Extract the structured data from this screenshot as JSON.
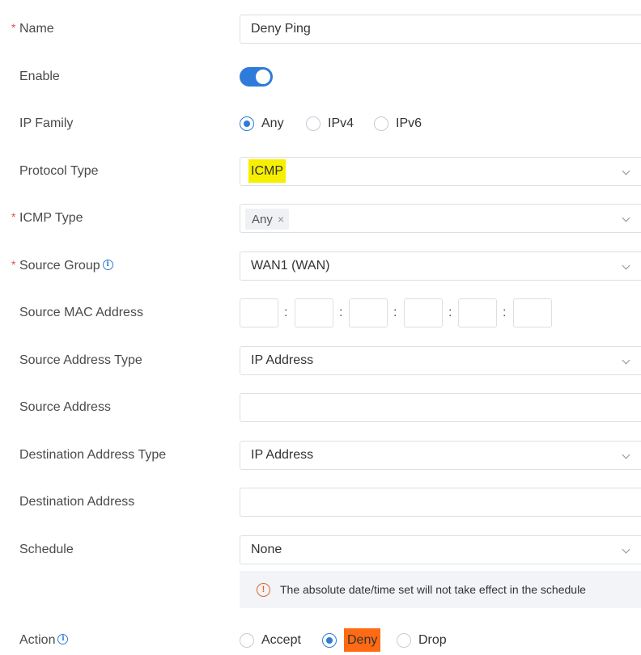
{
  "form": {
    "name": {
      "label": "Name",
      "required": "*",
      "value": "Deny Ping"
    },
    "enable": {
      "label": "Enable",
      "on": true
    },
    "ip_family": {
      "label": "IP Family",
      "options": [
        "Any",
        "IPv4",
        "IPv6"
      ],
      "selected": "Any"
    },
    "protocol_type": {
      "label": "Protocol Type",
      "value": "ICMP"
    },
    "icmp_type": {
      "label": "ICMP Type",
      "required": "*",
      "tag": "Any",
      "tag_remove": "×"
    },
    "source_group": {
      "label": "Source Group",
      "required": "*",
      "value": "WAN1 (WAN)",
      "info": "i"
    },
    "source_mac": {
      "label": "Source MAC Address",
      "separator": ":"
    },
    "source_address_type": {
      "label": "Source Address Type",
      "value": "IP Address"
    },
    "source_address": {
      "label": "Source Address",
      "value": ""
    },
    "destination_address_type": {
      "label": "Destination Address Type",
      "value": "IP Address"
    },
    "destination_address": {
      "label": "Destination Address",
      "value": ""
    },
    "schedule": {
      "label": "Schedule",
      "value": "None",
      "notice": "The absolute date/time set will not take effect in the schedule",
      "notice_icon": "!"
    },
    "action": {
      "label": "Action",
      "info": "i",
      "options": [
        "Accept",
        "Deny",
        "Drop"
      ],
      "selected": "Deny"
    }
  },
  "colors": {
    "accent": "#2f7bd9",
    "required": "#e34d59",
    "highlight_yellow": "#f7ef00",
    "highlight_orange": "#ff6a13",
    "warning": "#e0642a"
  },
  "icons": {
    "info": "info-icon",
    "warning": "warning-icon",
    "dropdown": "chevron-down-icon",
    "remove": "close-icon"
  }
}
